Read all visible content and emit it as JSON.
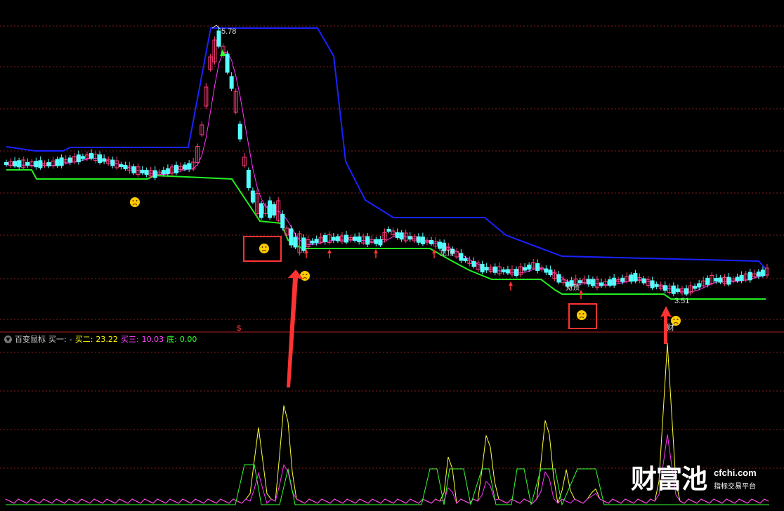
{
  "colors": {
    "background": "#000000",
    "grid": "#8a1c1c",
    "divider": "#b02020",
    "candle_up": "#ff3c7a",
    "candle_down": "#54ffff",
    "upper_band": "#1a22ff",
    "lower_band": "#22ee22",
    "ma": "#ff33ff",
    "ind_yellow": "#ffff33",
    "ind_magenta": "#ff33ff",
    "ind_green": "#33ff33",
    "annotation_red": "#ff3333",
    "sad_face": "#ffcc00"
  },
  "price_panel": {
    "high_label": "5.78",
    "divider_marker": "$",
    "stage_label_1": "见顶",
    "stage_label_2": "见顶",
    "low_label": "3.51",
    "low_marker": "财"
  },
  "indicator": {
    "name": "百变鼠标",
    "buy1_label": "买一:",
    "buy1_value": "-",
    "buy2_label": "买二:",
    "buy2_value": "23.22",
    "buy3_label": "买三:",
    "buy3_value": "10.03",
    "bottom_label": "底:",
    "bottom_value": "0.00"
  },
  "watermark": {
    "brand": "财富池",
    "url": "cfchi.com",
    "tagline": "指标交易平台"
  },
  "chart_data": [
    {
      "type": "candlestick",
      "panel": "price",
      "high_annotation": 5.78,
      "low_annotation": 3.51,
      "up_arrows_at_bars": [
        71,
        77,
        88,
        101,
        120,
        136
      ],
      "sad_faces_at_bars": [
        31,
        69,
        100,
        136
      ],
      "boxed_faces_at_bars": [
        69,
        136
      ],
      "big_arrows_at_bars": [
        68,
        157
      ]
    },
    {
      "type": "line",
      "panel": "indicator",
      "title": "百变鼠标",
      "legend": [
        "买一",
        "买二",
        "买三",
        "底"
      ],
      "series": [
        {
          "name": "买二",
          "value": 23.22,
          "color": "#ffff33"
        },
        {
          "name": "买三",
          "value": 10.03,
          "color": "#ff33ff"
        },
        {
          "name": "底",
          "value": 0.0,
          "color": "#33ff33"
        }
      ],
      "peaks_at_bars": [
        61,
        67,
        108,
        115,
        128,
        157
      ]
    }
  ]
}
